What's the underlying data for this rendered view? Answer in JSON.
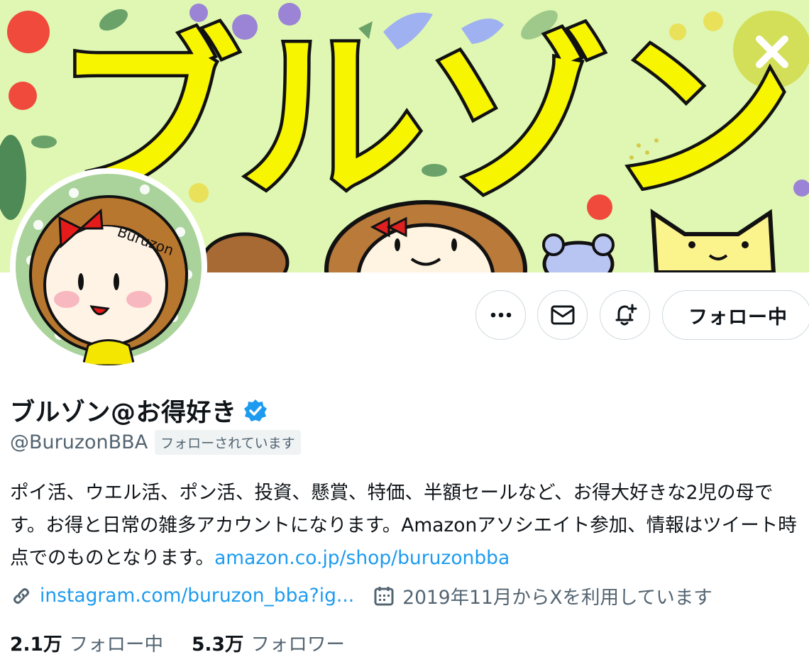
{
  "banner": {
    "title_art": "ブルゾン"
  },
  "actions": {
    "follow_label": "フォロー中"
  },
  "profile": {
    "display_name": "ブルゾン@お得好き",
    "handle": "@BuruzonBBA",
    "follows_you": "フォローされています",
    "avatar_text": "Buruzon",
    "bio_text": "ポイ活、ウエル活、ポン活、投資、懸賞、特価、半額セールなど、お得大好きな2児の母です。お得と日常の雑多アカウントになります。Amazonアソシエイト参加、情報はツイート時点でのものとなります。",
    "bio_link": "amazon.co.jp/shop/buruzonbba",
    "website": "instagram.com/buruzon_bba?ig...",
    "joined": "2019年11月からXを利用しています"
  },
  "stats": {
    "following_count": "2.1万",
    "following_label": "フォロー中",
    "followers_count": "5.3万",
    "followers_label": "フォロワー"
  },
  "icons": [
    "more-icon",
    "mail-icon",
    "notification-bell-icon",
    "verified-badge-icon",
    "link-icon",
    "calendar-icon"
  ],
  "colors": {
    "accent": "#1d9bf0",
    "banner_bg": "#dff7b2",
    "title_yellow": "#f8f500",
    "text_secondary": "#536471"
  }
}
